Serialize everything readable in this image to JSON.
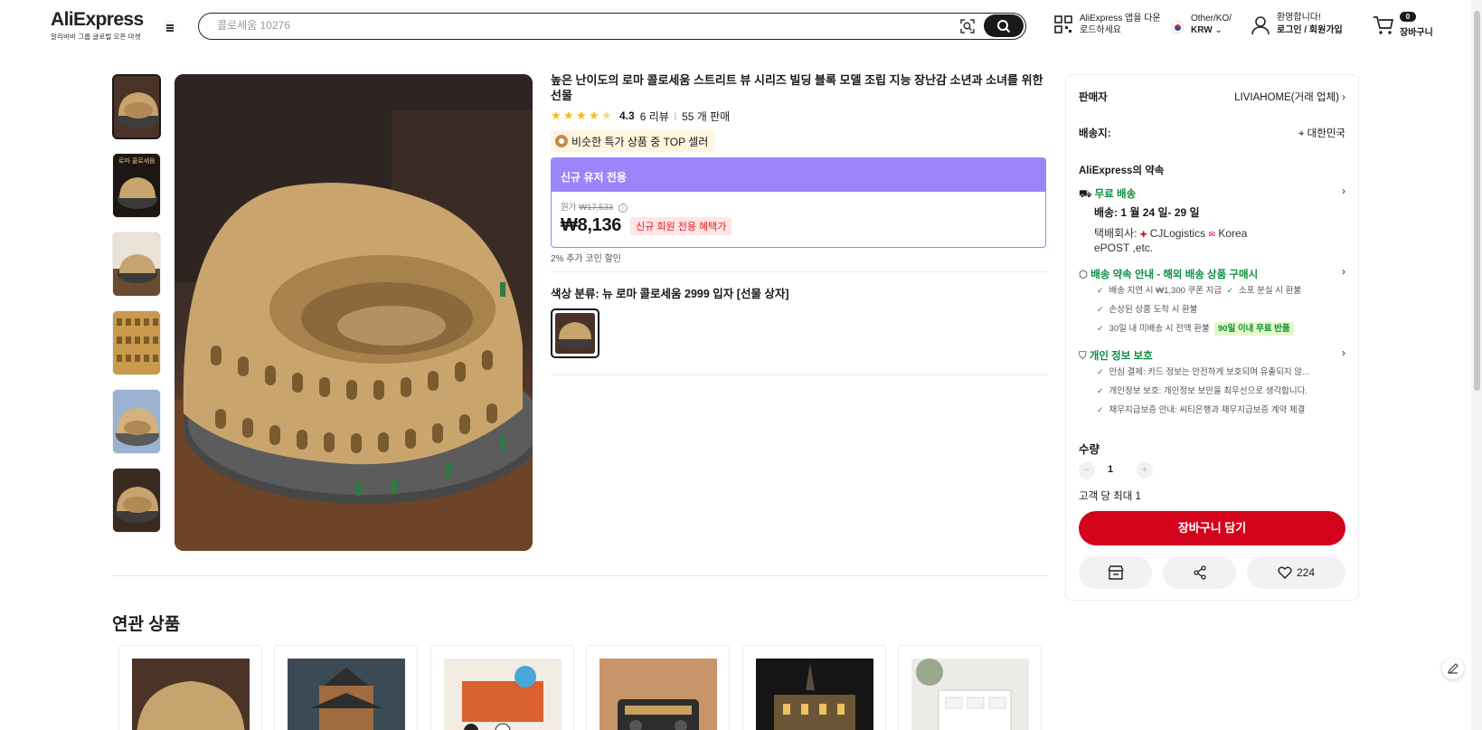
{
  "header": {
    "logo": "AliExpress",
    "logo_sub": "알리바바 그룹 글로벌 오픈 마켓",
    "search_placeholder": "콜로세움 10276",
    "app_download": "AliExpress 앱을 다운로드하세요",
    "region_line": "Other/KO/",
    "currency": "KRW",
    "greeting": "환영합니다!",
    "login": "로그인 / 회원가입",
    "cart_count": "0",
    "cart_label": "장바구니"
  },
  "product": {
    "title": "높은 난이도의 로마 콜로세움 스트리트 뷰 시리즈 빌딩 블록 모델 조립 지능 장난감 소년과 소녀를 위한 선물",
    "rating": "4.3",
    "reviews": "6 리뷰",
    "sold": "55 개 판매",
    "top_badge": "비슷한 특가 상품 중 TOP 셀러",
    "deal_header": "신규 유저 전용",
    "original_label": "원가",
    "original_price": "₩17,533",
    "price": "₩8,136",
    "price_tag": "신규 회원 전용 혜택가",
    "coin_note": "2% 추가 코인 할인",
    "color_label": "색상 분류: 뉴 로마 콜로세움 2999 입자 [선물 상자]"
  },
  "panel": {
    "seller_label": "판매자",
    "seller_name": "LIVIAHOME(거래 업체)",
    "ship_to_label": "배송지:",
    "ship_to": "대한민국",
    "promise_title": "AliExpress의 약속",
    "free_ship": "무료 배송",
    "delivery": "배송: 1 월 24 일- 29 일",
    "carrier_label": "택배회사:",
    "carrier_1": "CJLogistics",
    "carrier_2": "Korea",
    "carrier_3": "ePOST ,etc.",
    "guarantee_title": "배송 약속 안내 - 해외 배송 상품 구매시",
    "guarantee_items": [
      "배송 지연 시 ₩1,300 쿠폰 지급",
      "소포 분실 시 환불",
      "손상된 상품 도착 시 환불",
      "30일 내 미배송 시 전액 환불"
    ],
    "return_pill": "90일 이내 무료 반품",
    "privacy_title": "개인 정보 보호",
    "privacy_items": [
      "안심 결제: 카드 정보는 안전하게 보호되며 유출되지 않...",
      "개인정보 보호: 개인정보 보안을 최우선으로 생각합니다.",
      "채무지급보증 안내: 씨티은행과 채무지급보증 계약 체결"
    ],
    "qty_label": "수량",
    "qty_value": "1",
    "qty_limit": "고객 당 최대 1",
    "cart_btn": "장바구니 담기",
    "wish_count": "224"
  },
  "related": {
    "title": "연관 상품"
  },
  "colors": {
    "brand_red": "#d3031c",
    "deal_purple": "#9c85fb",
    "green": "#0a8f3d",
    "star": "#fdb713"
  }
}
